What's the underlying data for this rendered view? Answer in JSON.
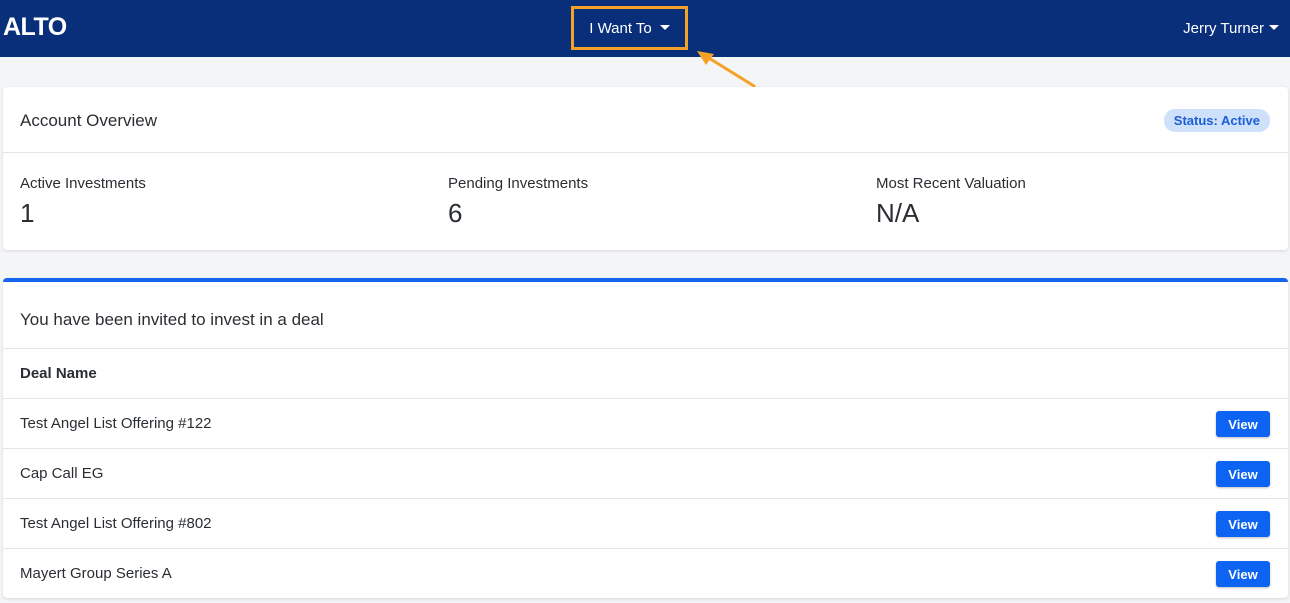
{
  "navbar": {
    "brand": "ALTO",
    "want_menu_label": "I Want To",
    "user_name": "Jerry Turner"
  },
  "overview": {
    "title": "Account Overview",
    "status_badge": "Status: Active",
    "stats": [
      {
        "label": "Active Investments",
        "value": "1"
      },
      {
        "label": "Pending Investments",
        "value": "6"
      },
      {
        "label": "Most Recent Valuation",
        "value": "N/A"
      }
    ]
  },
  "invites": {
    "title": "You have been invited to invest in a deal",
    "column_header": "Deal Name",
    "rows": [
      {
        "name": "Test Angel List Offering #122",
        "action": "View"
      },
      {
        "name": "Cap Call EG",
        "action": "View"
      },
      {
        "name": "Test Angel List Offering #802",
        "action": "View"
      },
      {
        "name": "Mayert Group Series A",
        "action": "View"
      }
    ]
  },
  "colors": {
    "navbar_bg": "#0a2f7a",
    "highlight": "#f5a128",
    "accent": "#1565f0",
    "badge_bg": "#cfe0fb"
  },
  "icons": [
    "caret-down-icon",
    "annotation-arrow-icon"
  ]
}
